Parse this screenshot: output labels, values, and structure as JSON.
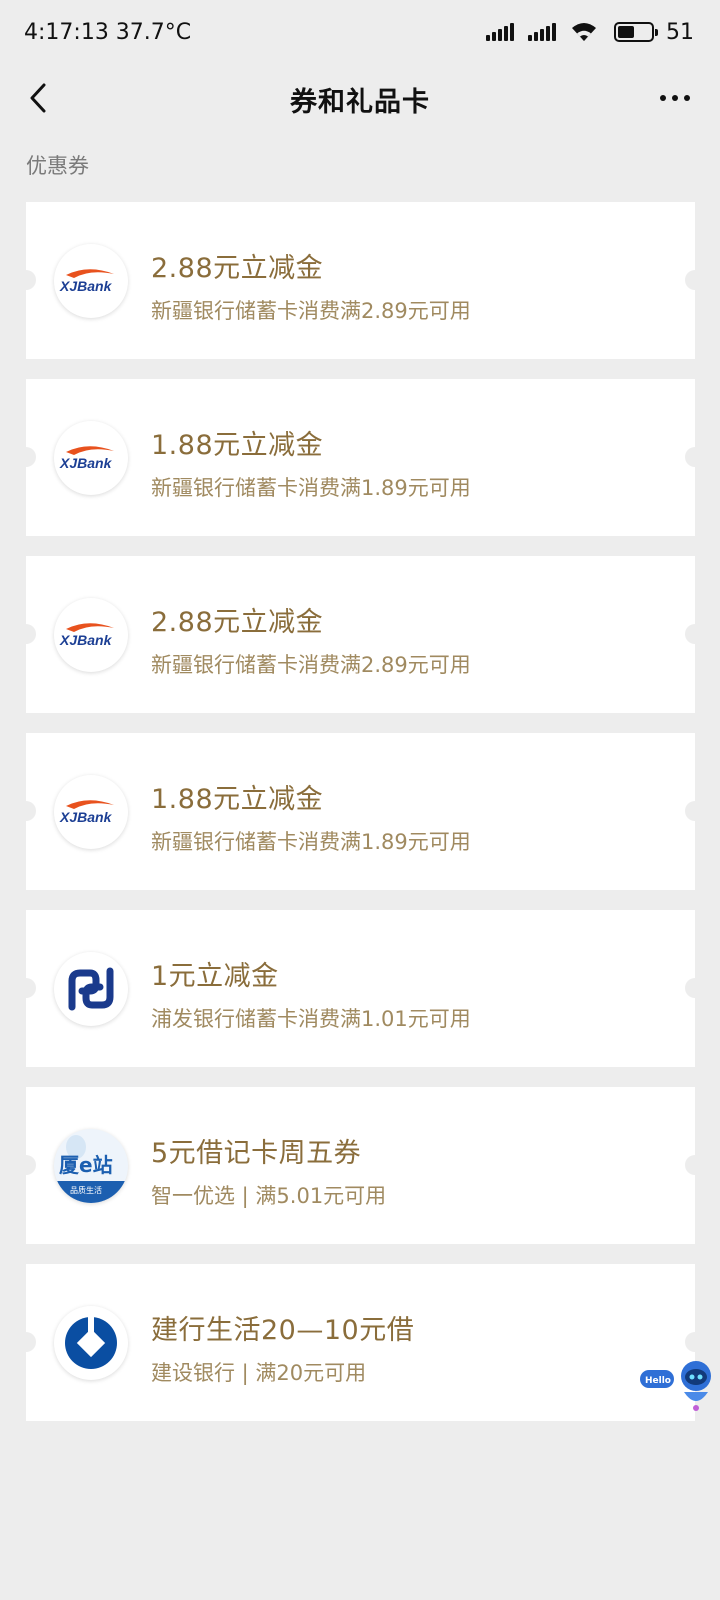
{
  "status_bar": {
    "time_temp": "4:17:13 37.7°C",
    "battery_level": "51",
    "battery_fraction": 0.51
  },
  "nav": {
    "title": "券和礼品卡"
  },
  "section": {
    "label": "优惠券"
  },
  "coupons": [
    {
      "title": "2.88元立减金",
      "desc": "新疆银行储蓄卡消费满2.89元可用",
      "logo": "xjbank-logo",
      "logo_text": "XJBank"
    },
    {
      "title": "1.88元立减金",
      "desc": "新疆银行储蓄卡消费满1.89元可用",
      "logo": "xjbank-logo",
      "logo_text": "XJBank"
    },
    {
      "title": "2.88元立减金",
      "desc": "新疆银行储蓄卡消费满2.89元可用",
      "logo": "xjbank-logo",
      "logo_text": "XJBank"
    },
    {
      "title": "1.88元立减金",
      "desc": "新疆银行储蓄卡消费满1.89元可用",
      "logo": "xjbank-logo",
      "logo_text": "XJBank"
    },
    {
      "title": "1元立减金",
      "desc": "浦发银行储蓄卡消费满1.01元可用",
      "logo": "spdb-logo"
    },
    {
      "title": "5元借记卡周五券",
      "desc": "智一优选 | 满5.01元可用",
      "logo": "xia-e-zhan-logo",
      "logo_text": "厦e站",
      "logo_subtext": "品质生活"
    },
    {
      "title": "建行生活20—10元借",
      "desc": "建设银行 | 满20元可用",
      "logo": "ccb-logo"
    }
  ],
  "assistant": {
    "badge": "Hello"
  },
  "colors": {
    "background": "#ededed",
    "coupon_title": "#8a6d3b",
    "coupon_desc": "#a08a60",
    "xjbank_blue": "#1c3f94",
    "xjbank_orange": "#e8521e",
    "spdb_blue": "#1a3a8c",
    "ccb_blue": "#0a4ea2"
  }
}
